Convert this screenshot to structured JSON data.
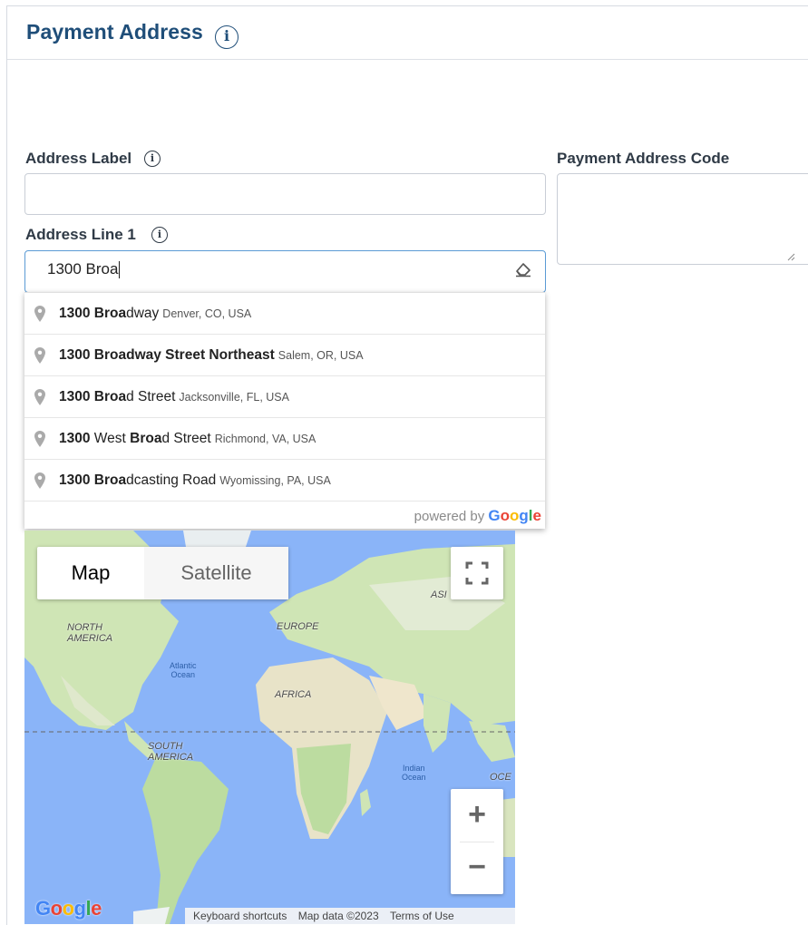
{
  "panel": {
    "title": "Payment Address"
  },
  "form": {
    "address_label": {
      "label": "Address Label",
      "value": ""
    },
    "payment_address_code": {
      "label": "Payment Address Code",
      "value": ""
    },
    "address_line1": {
      "label": "Address Line 1",
      "value": "1300 Broa"
    }
  },
  "autocomplete": {
    "suggestions": [
      {
        "bold": "1300 Broa",
        "rest": "dway",
        "secondary": "Denver, CO, USA"
      },
      {
        "bold": "1300 Broa",
        "rest": "dway Street Northeast",
        "secondary": "Salem, OR, USA"
      },
      {
        "bold": "1300 Broa",
        "rest": "d Street",
        "secondary": "Jacksonville, FL, USA"
      },
      {
        "bold": "1300",
        "mid": " West ",
        "bold2": "Broa",
        "rest": "d Street",
        "secondary": "Richmond, VA, USA"
      },
      {
        "bold": "1300 Broa",
        "rest": "dcasting Road",
        "secondary": "Wyomissing, PA, USA"
      }
    ],
    "powered_by": "powered by",
    "google": "Google"
  },
  "map": {
    "type_buttons": [
      "Map",
      "Satellite"
    ],
    "selected_type": "Map",
    "labels": {
      "north_america": "NORTH\nAMERICA",
      "europe": "EUROPE",
      "asia": "ASI",
      "africa": "AFRICA",
      "south_america": "SOUTH\nAMERICA",
      "atlantic": "Atlantic\nOcean",
      "indian": "Indian\nOcean",
      "oceania": "OCE"
    },
    "footer": {
      "keyboard_shortcuts": "Keyboard shortcuts",
      "map_data": "Map data ©2023",
      "terms": "Terms of Use"
    },
    "logo": "Google",
    "water_color": "#8ab4f8",
    "land_color": "#cfe5b5"
  },
  "colors": {
    "title": "#1f4e79",
    "focus_border": "#5b9bd5"
  }
}
